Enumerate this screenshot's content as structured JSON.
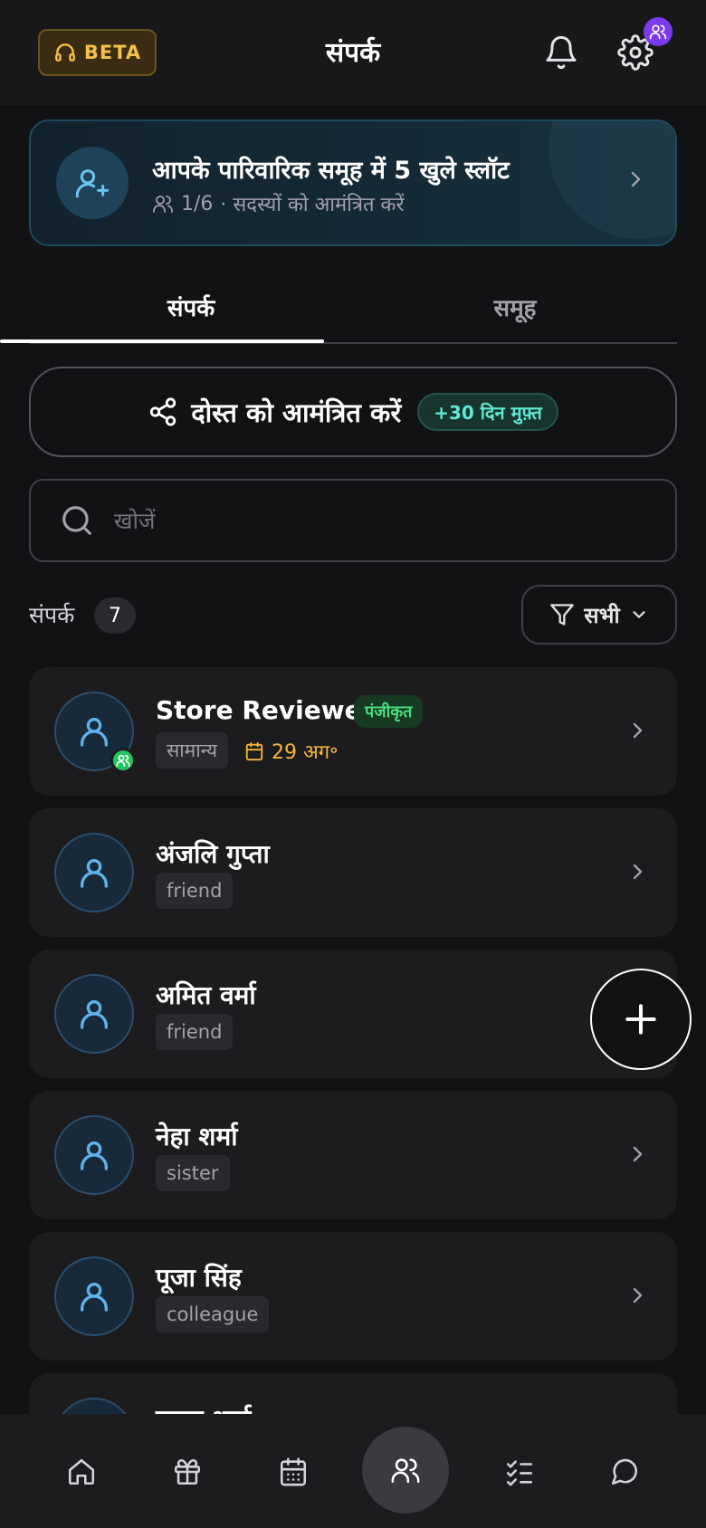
{
  "header": {
    "beta_label": "BETA",
    "title": "संपर्क",
    "icons": [
      "headset-icon",
      "bell-icon",
      "gear-icon",
      "users-icon"
    ]
  },
  "family_banner": {
    "title": "आपके पारिवारिक समूह में 5 खुले स्लॉट",
    "count": "1/6",
    "subtitle": "· सदस्यों को आमंत्रित करें"
  },
  "tabs": [
    {
      "label": "संपर्क",
      "active": true
    },
    {
      "label": "समूह",
      "active": false
    }
  ],
  "invite": {
    "label": "दोस्त को आमंत्रित करें",
    "badge": "+30 दिन मुफ़्त"
  },
  "search": {
    "placeholder": "खोजें"
  },
  "contacts_header": {
    "label": "संपर्क",
    "count": "7",
    "filter_label": "सभी"
  },
  "contacts": [
    {
      "name": "Store Reviewer",
      "badge": "पंजीकृत",
      "tag": "सामान्य",
      "date": "29 अग॰"
    },
    {
      "name": "अंजलि गुप्ता",
      "tag": "friend"
    },
    {
      "name": "अमित वर्मा",
      "tag": "friend"
    },
    {
      "name": "नेहा शर्मा",
      "tag": "sister"
    },
    {
      "name": "पूजा सिंह",
      "tag": "colleague"
    },
    {
      "name": "राहुल शर्मा",
      "tag": ""
    }
  ],
  "colors": {
    "background": "#121214",
    "card": "#1c1c1f",
    "accent_blue": "#5fb3ec",
    "beta_gold": "#f5c04a",
    "registered_green": "#4ade80",
    "badge_teal": "#5eead4",
    "badge_purple": "#7c3aed"
  },
  "bottom_nav": [
    "home-icon",
    "gift-icon",
    "calendar-icon",
    "users-icon",
    "checklist-icon",
    "chat-icon"
  ]
}
